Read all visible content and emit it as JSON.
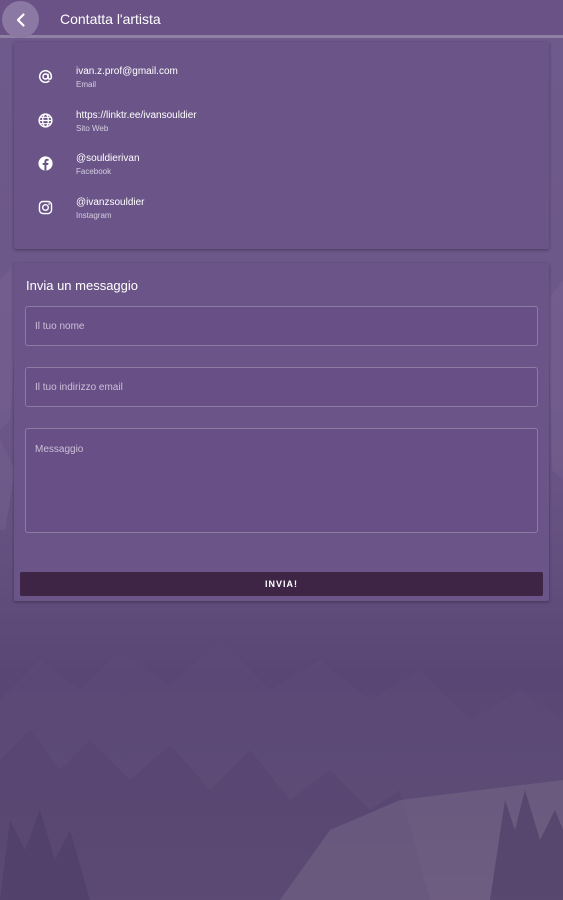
{
  "header": {
    "title": "Contatta l'artista",
    "back_icon": "chevron-left-icon"
  },
  "contacts": [
    {
      "icon": "at-icon",
      "value": "ivan.z.prof@gmail.com",
      "label": "Email"
    },
    {
      "icon": "globe-icon",
      "value": "https://linktr.ee/ivansouldier",
      "label": "Sito Web"
    },
    {
      "icon": "facebook-icon",
      "value": "@souldierivan",
      "label": "Facebook"
    },
    {
      "icon": "instagram-icon",
      "value": "@ivanzsouldier",
      "label": "Instagram"
    }
  ],
  "message_form": {
    "heading": "Invia un messaggio",
    "name_placeholder": "Il tuo nome",
    "email_placeholder": "Il tuo indirizzo email",
    "message_placeholder": "Messaggio",
    "send_label": "INVIA!"
  },
  "colors": {
    "accent": "#6b5588",
    "button": "#3e2545",
    "background": "#6d5688"
  }
}
